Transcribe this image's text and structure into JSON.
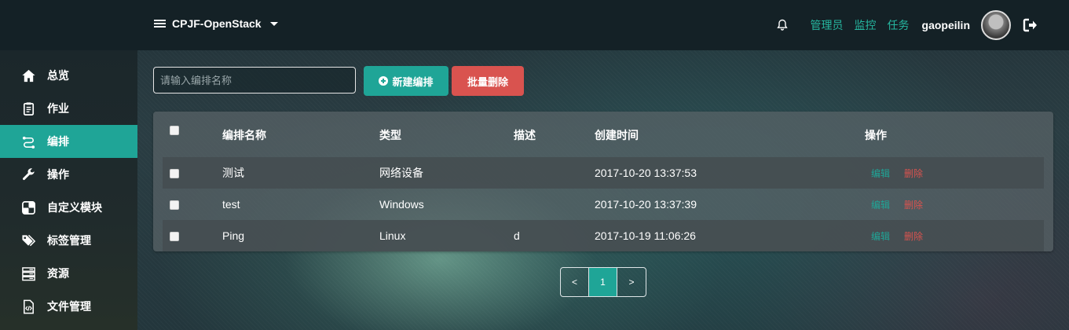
{
  "header": {
    "brand": "CPJF-OpenStack",
    "links": [
      "管理员",
      "监控",
      "任务"
    ],
    "username": "gaopeilin"
  },
  "sidebar": {
    "items": [
      {
        "label": "总览",
        "icon": "home-icon"
      },
      {
        "label": "作业",
        "icon": "clipboard-icon"
      },
      {
        "label": "编排",
        "icon": "flow-icon",
        "active": true
      },
      {
        "label": "操作",
        "icon": "wrench-icon"
      },
      {
        "label": "自定义模块",
        "icon": "puzzle-icon"
      },
      {
        "label": "标签管理",
        "icon": "tags-icon"
      },
      {
        "label": "资源",
        "icon": "server-icon"
      },
      {
        "label": "文件管理",
        "icon": "code-file-icon"
      }
    ]
  },
  "toolbar": {
    "search_placeholder": "请输入编排名称",
    "new_label": "新建编排",
    "batch_delete_label": "批量删除"
  },
  "table": {
    "headers": {
      "name": "编排名称",
      "type": "类型",
      "desc": "描述",
      "time": "创建时间",
      "actions": "操作"
    },
    "rows": [
      {
        "name": "测试",
        "type": "网络设备",
        "desc": "",
        "time": "2017-10-20 13:37:53"
      },
      {
        "name": "test",
        "type": "Windows",
        "desc": "",
        "time": "2017-10-20 13:37:39"
      },
      {
        "name": "Ping",
        "type": "Linux",
        "desc": "d",
        "time": "2017-10-19 11:06:26"
      }
    ],
    "edit_label": "编辑",
    "delete_label": "删除"
  },
  "pagination": {
    "prev": "<",
    "current": "1",
    "next": ">"
  },
  "colors": {
    "accent": "#1fa597",
    "danger": "#d9534f",
    "topbar": "#142126"
  }
}
